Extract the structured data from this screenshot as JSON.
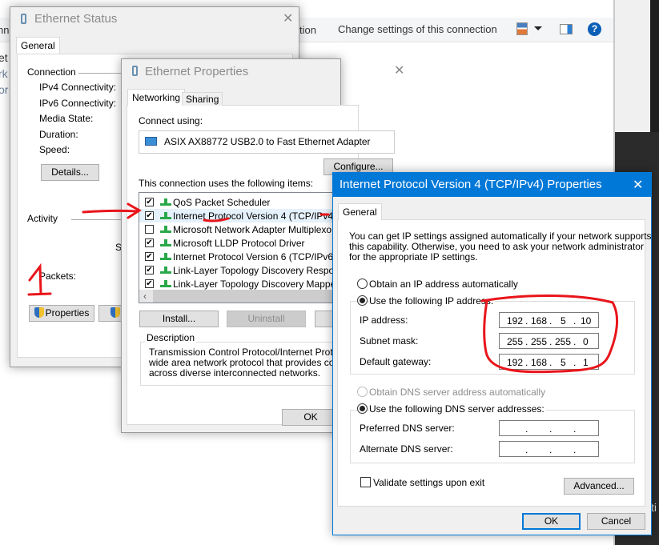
{
  "background": {
    "toolbar_fragment_left": "nn",
    "toolbar_fragment_mid": "tion",
    "change_settings": "Change settings of this connection",
    "left_fragments": [
      "et",
      "rk",
      "or"
    ],
    "bottom_right_fragment": "ti",
    "icons": [
      "view-options-icon",
      "chevron-down-icon",
      "preview-pane-icon",
      "help-icon"
    ]
  },
  "ethernet_status": {
    "title": "Ethernet Status",
    "tab": "General",
    "connection_label": "Connection",
    "fields": [
      "IPv4 Connectivity:",
      "IPv6 Connectivity:",
      "Media State:",
      "Duration:",
      "Speed:"
    ],
    "details_button": "Details...",
    "activity_label": "Activity",
    "sent_fragment": "Se",
    "packets_label": "Packets:",
    "properties_button": "Properties"
  },
  "ethernet_properties": {
    "title": "Ethernet Properties",
    "tabs": [
      "Networking",
      "Sharing"
    ],
    "connect_using": "Connect using:",
    "adapter": "ASIX AX88772 USB2.0 to Fast Ethernet Adapter",
    "configure_button": "Configure...",
    "items_label": "This connection uses the following items:",
    "items": [
      {
        "label": "QoS Packet Scheduler",
        "checked": true
      },
      {
        "label": "Internet Protocol Version 4 (TCP/IPv4)",
        "checked": true,
        "selected": true
      },
      {
        "label": "Microsoft Network Adapter Multiplexor Pro",
        "checked": false
      },
      {
        "label": "Microsoft LLDP Protocol Driver",
        "checked": true
      },
      {
        "label": "Internet Protocol Version 6 (TCP/IPv6)",
        "checked": true
      },
      {
        "label": "Link-Layer Topology Discovery Responde",
        "checked": true
      },
      {
        "label": "Link-Layer Topology Discovery Mapper I/C",
        "checked": true
      }
    ],
    "install_button": "Install...",
    "uninstall_button": "Uninstall",
    "description_label": "Description",
    "description": [
      "Transmission Control Protocol/Internet Protocol.",
      "wide area network protocol that provides commu",
      "across diverse interconnected networks."
    ],
    "ok_button": "OK"
  },
  "ipv4_properties": {
    "title": "Internet Protocol Version 4 (TCP/IPv4) Properties",
    "title_color": "#0078d7",
    "tab": "General",
    "intro": [
      "You can get IP settings assigned automatically if your network supports",
      "this capability. Otherwise, you need to ask your network administrator",
      "for the appropriate IP settings."
    ],
    "obtain_ip_auto": "Obtain an IP address automatically",
    "use_following_ip": "Use the following IP address:",
    "ip_address_label": "IP address:",
    "ip_address": [
      "192",
      "168",
      "5",
      "10"
    ],
    "subnet_label": "Subnet mask:",
    "subnet": [
      "255",
      "255",
      "255",
      "0"
    ],
    "gateway_label": "Default gateway:",
    "gateway": [
      "192",
      "168",
      "5",
      "1"
    ],
    "obtain_dns_auto": "Obtain DNS server address automatically",
    "use_following_dns": "Use the following DNS server addresses:",
    "preferred_dns_label": "Preferred DNS server:",
    "alternate_dns_label": "Alternate DNS server:",
    "validate_label": "Validate settings upon exit",
    "validate_checked": false,
    "advanced_button": "Advanced...",
    "ok_button": "OK",
    "cancel_button": "Cancel"
  },
  "annotation_color": "#e8151b"
}
